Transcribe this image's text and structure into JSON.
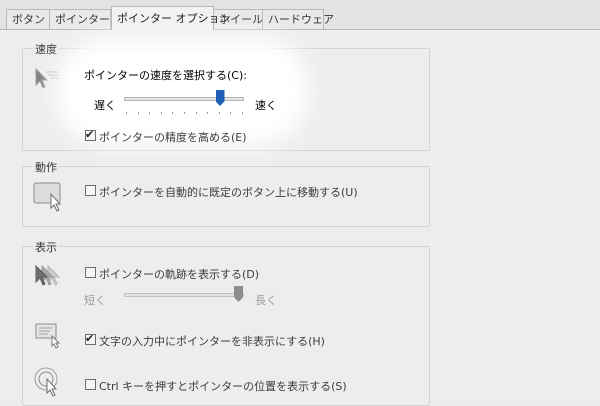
{
  "tabs": [
    {
      "label": "ボタン"
    },
    {
      "label": "ポインター"
    },
    {
      "label": "ポインター オプション"
    },
    {
      "label": "ホイール"
    },
    {
      "label": "ハードウェア"
    }
  ],
  "speed": {
    "group_title": "速度",
    "select_label": "ポインターの速度を選択する(C):",
    "slow_label": "遅く",
    "fast_label": "速く",
    "slider_value_fraction": 0.8,
    "precision_label": "ポインターの精度を高める(E)",
    "precision_checked": true
  },
  "snap": {
    "group_title": "動作",
    "snap_label": "ポインターを自動的に既定のボタン上に移動する(U)",
    "snap_checked": false
  },
  "visibility": {
    "group_title": "表示",
    "trails_label": "ポインターの軌跡を表示する(D)",
    "trails_checked": false,
    "short_label": "短く",
    "long_label": "長く",
    "trail_slider_value_fraction": 1.0,
    "hide_typing_label": "文字の入力中にポインターを非表示にする(H)",
    "hide_typing_checked": true,
    "ctrl_label": "Ctrl キーを押すとポインターの位置を表示する(S)",
    "ctrl_checked": false
  },
  "colors": {
    "accent": "#1f5fb8",
    "spotlight": "#ffffff",
    "dim_bg": "#ededed"
  }
}
